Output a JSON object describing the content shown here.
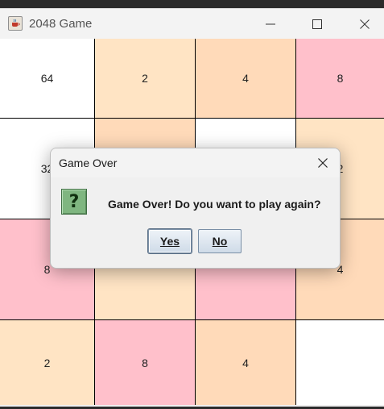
{
  "window": {
    "title": "2048 Game",
    "app_icon": "java-cup-icon",
    "controls": [
      "minimize-icon",
      "maximize-icon",
      "close-icon"
    ]
  },
  "board": {
    "rows": 4,
    "cols": 4,
    "tiles": [
      [
        {
          "value": "64",
          "color": "#ffffff"
        },
        {
          "value": "2",
          "color": "#ffe4c4"
        },
        {
          "value": "4",
          "color": "#ffdab9"
        },
        {
          "value": "8",
          "color": "#ffc0cb"
        }
      ],
      [
        {
          "value": "32",
          "color": "#ffffff"
        },
        {
          "value": "",
          "color": "#ffdab9"
        },
        {
          "value": "",
          "color": "#ffffff"
        },
        {
          "value": "2",
          "color": "#ffe4c4"
        }
      ],
      [
        {
          "value": "8",
          "color": "#ffc0cb"
        },
        {
          "value": "",
          "color": "#ffe4c4"
        },
        {
          "value": "",
          "color": "#ffc0cb"
        },
        {
          "value": "4",
          "color": "#ffdab9"
        }
      ],
      [
        {
          "value": "2",
          "color": "#ffe4c4"
        },
        {
          "value": "8",
          "color": "#ffc0cb"
        },
        {
          "value": "4",
          "color": "#ffdab9"
        },
        {
          "value": "",
          "color": "#ffffff"
        }
      ]
    ]
  },
  "dialog": {
    "title": "Game Over",
    "icon": "question-icon",
    "icon_glyph": "?",
    "message": "Game Over! Do you want to play again?",
    "yes_label": "Yes",
    "no_label": "No"
  }
}
